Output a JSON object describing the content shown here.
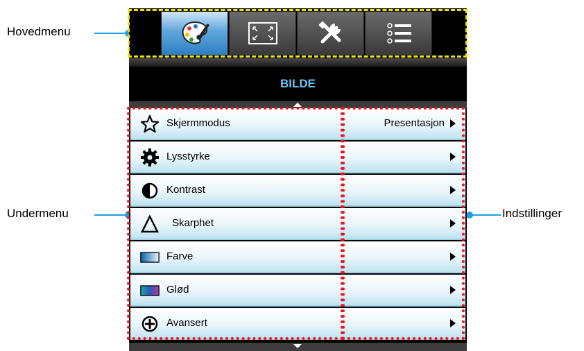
{
  "menu": {
    "title": "BILDE",
    "tabs": [
      {
        "icon": "palette-icon",
        "active": true
      },
      {
        "icon": "screen-resize-icon",
        "active": false
      },
      {
        "icon": "tools-icon",
        "active": false
      },
      {
        "icon": "list-icon",
        "active": false
      }
    ],
    "rows": [
      {
        "label": "Skjermmodus",
        "value": "Presentasjon",
        "icon": "star-icon"
      },
      {
        "label": "Lysstyrke",
        "value": "",
        "icon": "gear-icon"
      },
      {
        "label": "Kontrast",
        "value": "",
        "icon": "contrast-icon"
      },
      {
        "label": "Skarphet",
        "value": "",
        "icon": "delta-icon"
      },
      {
        "label": "Farve",
        "value": "",
        "icon": "color-swatch-icon"
      },
      {
        "label": "Glød",
        "value": "",
        "icon": "gradient-swatch-icon"
      },
      {
        "label": "Avansert",
        "value": "",
        "icon": "plus-circle-icon"
      }
    ]
  },
  "callouts": {
    "main_menu": "Hovedmenu",
    "sub_menu": "Undermenu",
    "settings": "Indstillinger"
  },
  "colors": {
    "callout_line": "#1aa0e4",
    "main_menu_frame": "#f2e600",
    "sub_menu_frame": "#f0141e",
    "title_text": "#68c3f0"
  }
}
